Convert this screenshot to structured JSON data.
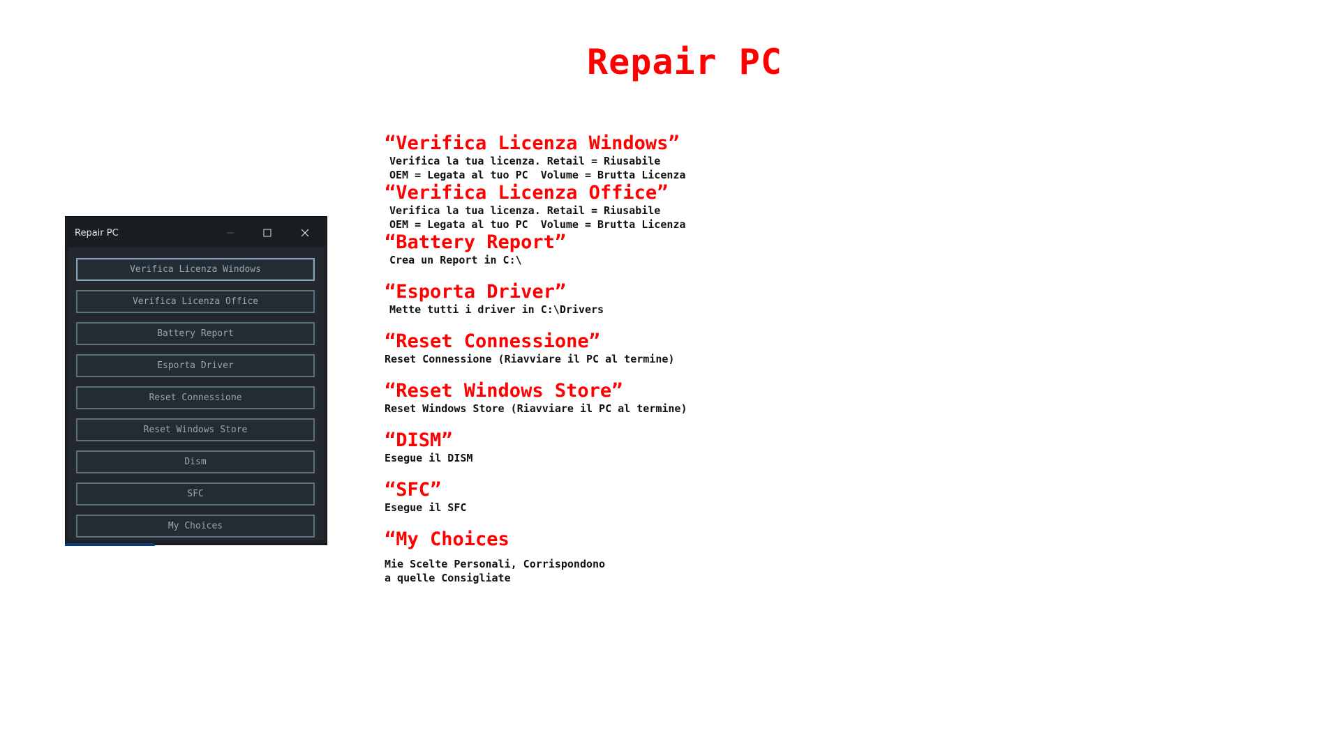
{
  "page": {
    "title": "Repair PC"
  },
  "window": {
    "title": "Repair PC",
    "controls": {
      "minimize": "minimize-icon",
      "maximize": "maximize-icon",
      "close": "close-icon"
    },
    "buttons": [
      {
        "label": "Verifica Licenza Windows"
      },
      {
        "label": "Verifica Licenza Office"
      },
      {
        "label": "Battery Report"
      },
      {
        "label": "Esporta Driver"
      },
      {
        "label": "Reset Connessione"
      },
      {
        "label": "Reset Windows Store"
      },
      {
        "label": "Dism"
      },
      {
        "label": "SFC"
      },
      {
        "label": "My Choices"
      }
    ]
  },
  "descriptions": [
    {
      "heading": "“Verifica Licenza Windows”",
      "lines": [
        "Verifica la tua licenza. Retail = Riusabile",
        "OEM = Legata al tuo PC  Volume = Brutta Licenza"
      ]
    },
    {
      "heading": "“Verifica Licenza Office”",
      "lines": [
        "Verifica la tua licenza. Retail = Riusabile",
        "OEM = Legata al tuo PC  Volume = Brutta Licenza"
      ]
    },
    {
      "heading": "“Battery Report”",
      "lines": [
        "Crea un Report in C:\\"
      ]
    },
    {
      "heading": "“Esporta Driver”",
      "lines": [
        "Mette tutti i driver in C:\\Drivers"
      ]
    },
    {
      "heading": "“Reset Connessione”",
      "lines": [
        "Reset Connessione (Riavviare il PC al termine)"
      ]
    },
    {
      "heading": "“Reset Windows Store”",
      "lines": [
        "Reset Windows Store (Riavviare il PC al termine)"
      ]
    },
    {
      "heading": "“DISM”",
      "lines": [
        "Esegue il DISM"
      ]
    },
    {
      "heading": "“SFC”",
      "lines": [
        "Esegue il SFC"
      ]
    },
    {
      "heading": "“My Choices",
      "lines": [
        "Mie Scelte Personali, Corrispondono",
        "a quelle Consigliate"
      ]
    }
  ],
  "colors": {
    "title_red": "#ff0000",
    "window_bg": "#23282e",
    "button_border": "#5d7080",
    "button_text": "#9aa6b0"
  }
}
